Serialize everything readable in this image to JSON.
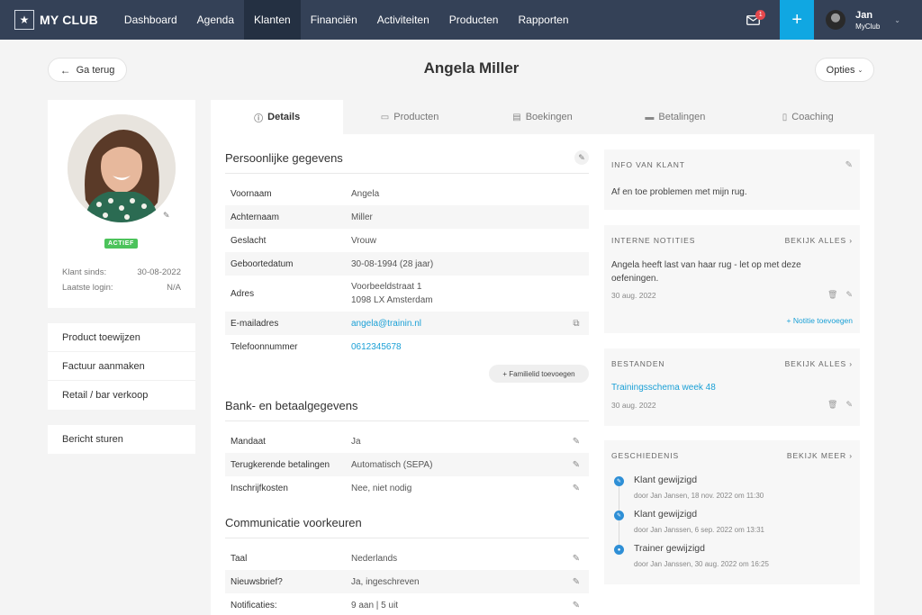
{
  "nav": {
    "logo": "MY CLUB",
    "items": [
      "Dashboard",
      "Agenda",
      "Klanten",
      "Financiën",
      "Activiteiten",
      "Producten",
      "Rapporten"
    ],
    "active": "Klanten",
    "mail_badge": "1",
    "plus_label": "+",
    "user": {
      "name": "Jan",
      "org": "MyClub"
    }
  },
  "header": {
    "back_label": "Ga terug",
    "title": "Angela Miller",
    "options_label": "Opties"
  },
  "profile": {
    "status": "ACTIEF",
    "meta": [
      {
        "label": "Klant sinds:",
        "value": "30-08-2022"
      },
      {
        "label": "Laatste login:",
        "value": "N/A"
      }
    ]
  },
  "actions": [
    "Product toewijzen",
    "Factuur aanmaken",
    "Retail / bar verkoop"
  ],
  "message_action": "Bericht sturen",
  "tabs": [
    {
      "label": "Details",
      "icon": "info-icon"
    },
    {
      "label": "Producten",
      "icon": "ticket-icon"
    },
    {
      "label": "Boekingen",
      "icon": "calendar-icon"
    },
    {
      "label": "Betalingen",
      "icon": "credit-card-icon"
    },
    {
      "label": "Coaching",
      "icon": "clipboard-icon"
    }
  ],
  "personal": {
    "title": "Persoonlijke gegevens",
    "rows": [
      {
        "label": "Voornaam",
        "value": "Angela"
      },
      {
        "label": "Achternaam",
        "value": "Miller"
      },
      {
        "label": "Geslacht",
        "value": "Vrouw"
      },
      {
        "label": "Geboortedatum",
        "value": "30-08-1994 (28 jaar)"
      },
      {
        "label": "Adres",
        "value": "Voorbeeldstraat 1",
        "value2": "1098 LX Amsterdam"
      },
      {
        "label": "E-mailadres",
        "value": "angela@trainin.nl"
      },
      {
        "label": "Telefoonnummer",
        "value": "0612345678"
      }
    ],
    "family_button": "+ Familielid toevoegen"
  },
  "bank": {
    "title": "Bank- en betaalgegevens",
    "rows": [
      {
        "label": "Mandaat",
        "value": "Ja"
      },
      {
        "label": "Terugkerende betalingen",
        "value": "Automatisch (SEPA)"
      },
      {
        "label": "Inschrijfkosten",
        "value": "Nee, niet nodig"
      }
    ]
  },
  "communication": {
    "title": "Communicatie voorkeuren",
    "rows": [
      {
        "label": "Taal",
        "value": "Nederlands"
      },
      {
        "label": "Nieuwsbrief?",
        "value": "Ja, ingeschreven"
      },
      {
        "label": "Notificaties:",
        "value": "9 aan | 5 uit"
      }
    ]
  },
  "info": {
    "title": "INFO VAN KLANT",
    "text": "Af en toe problemen met mijn rug."
  },
  "notes": {
    "title": "INTERNE NOTITIES",
    "more": "BEKIJK ALLES  ›",
    "text": "Angela heeft last van haar rug - let op met deze oefeningen.",
    "date": "30 aug. 2022",
    "add": "+  Notitie toevoegen"
  },
  "files": {
    "title": "BESTANDEN",
    "more": "BEKIJK ALLES  ›",
    "file": "Trainingsschema week 48",
    "date": "30 aug. 2022"
  },
  "history": {
    "title": "GESCHIEDENIS",
    "more": "BEKIJK MEER  ›",
    "items": [
      {
        "title": "Klant gewijzigd",
        "sub": "door Jan Jansen, 18 nov. 2022 om 11:30",
        "icon": "edit-icon"
      },
      {
        "title": "Klant gewijzigd",
        "sub": "door Jan Janssen, 6 sep. 2022 om 13:31",
        "icon": "edit-icon"
      },
      {
        "title": "Trainer gewijzigd",
        "sub": "door Jan Janssen, 30 aug. 2022 om 16:25",
        "icon": "user-icon"
      }
    ]
  },
  "colors": {
    "nav_bg": "#344157",
    "nav_active": "#243042",
    "accent": "#10a7e2",
    "link": "#1ba0d6",
    "status_green": "#4cc35b",
    "badge_red": "#e5484d",
    "timeline_blue": "#2e8fd6"
  }
}
